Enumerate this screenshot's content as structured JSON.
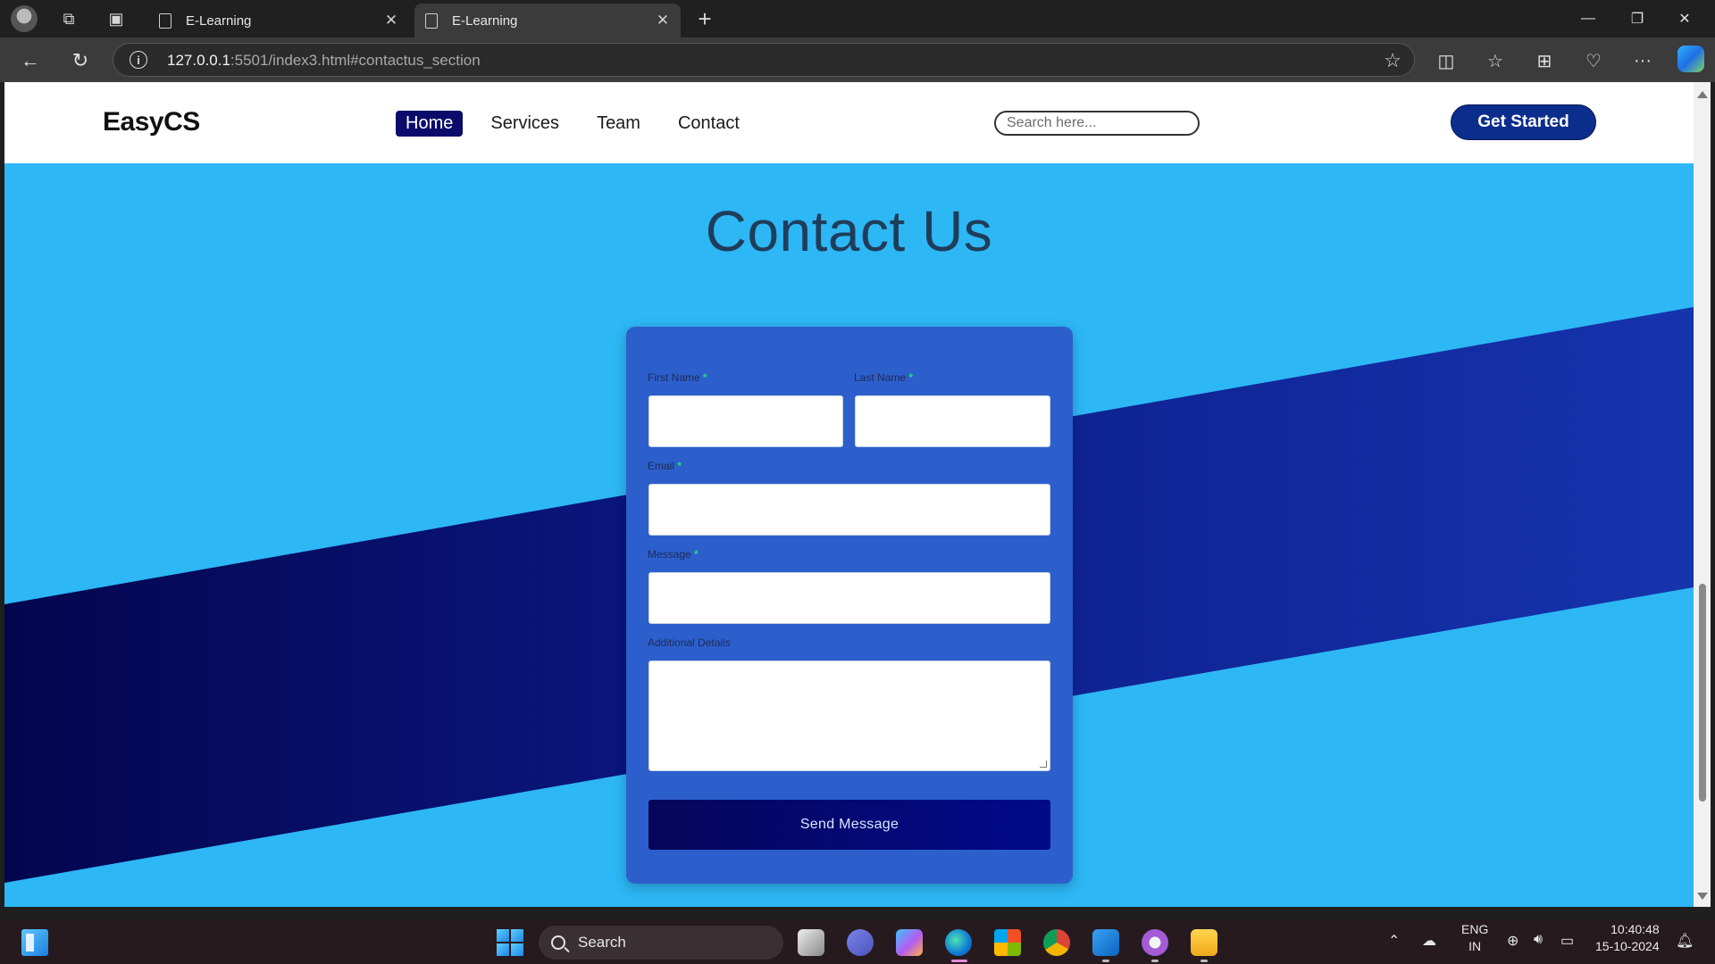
{
  "browser": {
    "tabs": [
      {
        "title": "E-Learning"
      },
      {
        "title": "E-Learning"
      }
    ],
    "url_host": "127.0.0.1",
    "url_rest": ":5501/index3.html#contactus_section"
  },
  "site": {
    "logo": "EasyCS",
    "nav": [
      {
        "label": "Home"
      },
      {
        "label": "Services"
      },
      {
        "label": "Team"
      },
      {
        "label": "Contact"
      }
    ],
    "search_placeholder": "Search here...",
    "cta": "Get Started",
    "heading": "Contact Us"
  },
  "form": {
    "first_name_label": "First Name",
    "last_name_label": "Last Name",
    "email_label": "Email",
    "message_label": "Message",
    "details_label": "Additional Details",
    "required_mark": "*",
    "submit": "Send Message"
  },
  "taskbar": {
    "search": "Search",
    "lang_top": "ENG",
    "lang_bottom": "IN",
    "time": "10:40:48",
    "date": "15-10-2024"
  },
  "colors": {
    "page_bg": "#2db7f5",
    "band_dark": "#0a0a5e",
    "band_mid": "#1530a8",
    "card": "#2d5fcc",
    "nav_active": "#0b0b6b",
    "cta": "#0b2d8c",
    "required": "#1de07a"
  }
}
